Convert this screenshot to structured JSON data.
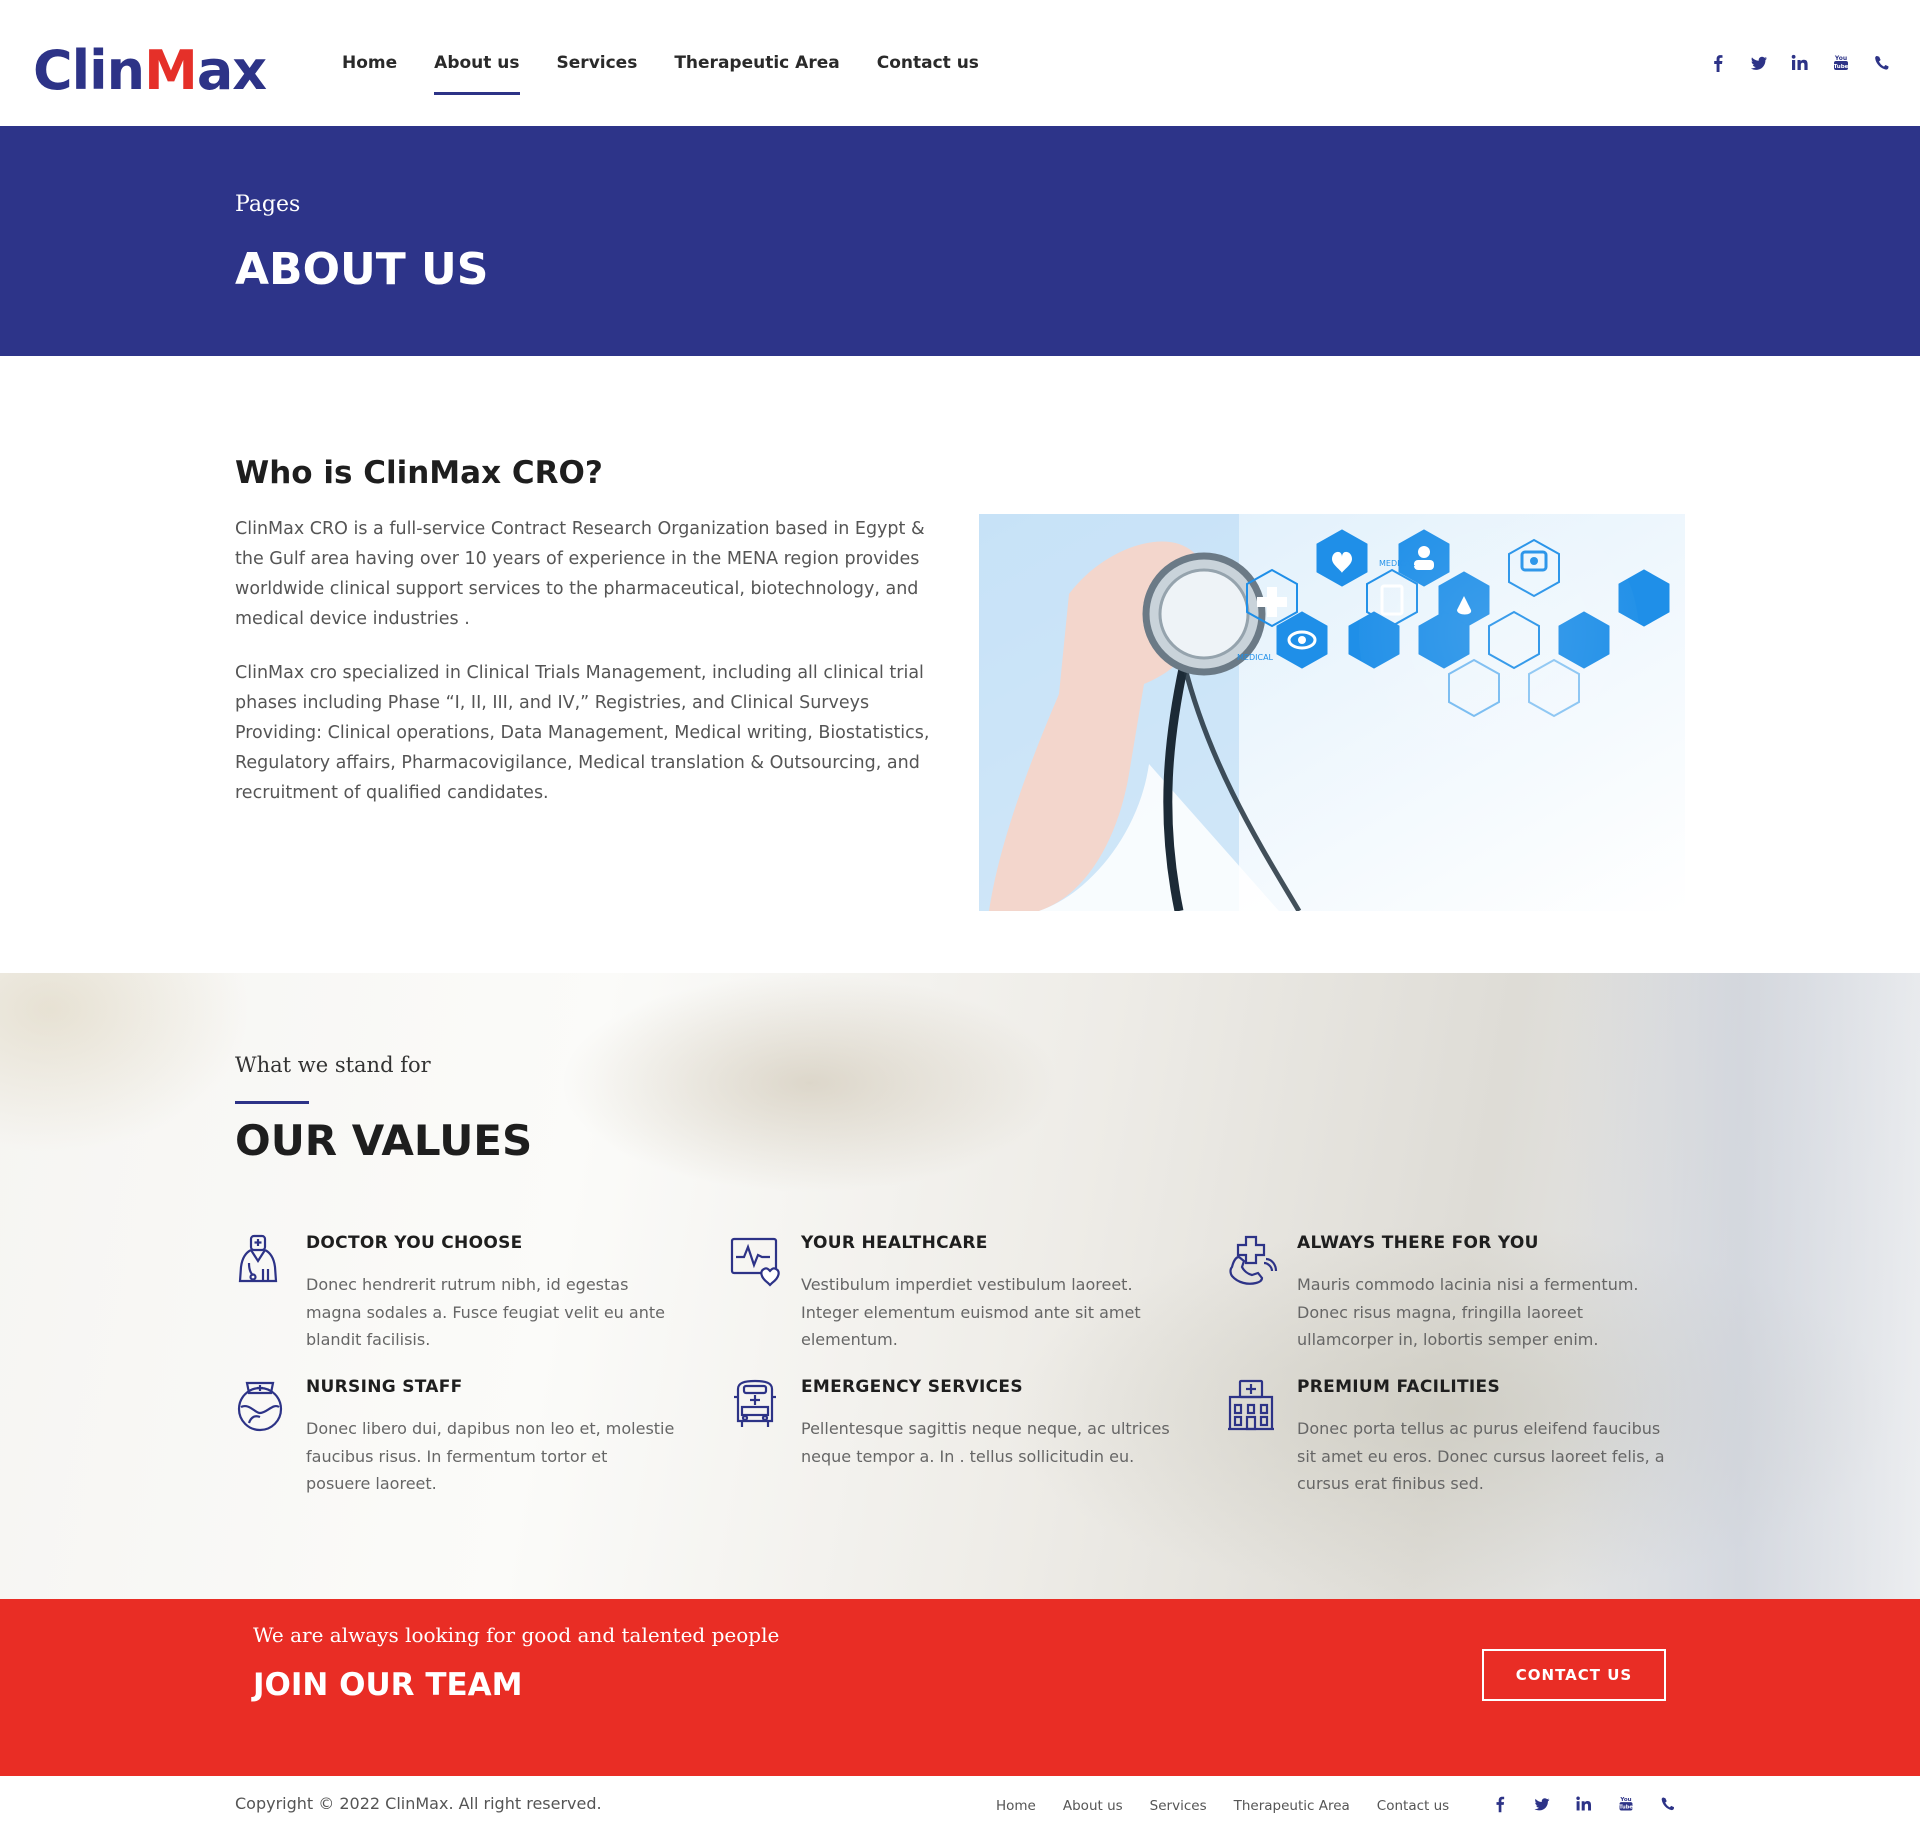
{
  "header": {
    "logo": {
      "part1": "Clin",
      "part2": "M",
      "part3": "ax"
    },
    "nav": [
      {
        "label": "Home",
        "active": false
      },
      {
        "label": "About us",
        "active": true
      },
      {
        "label": "Services",
        "active": false
      },
      {
        "label": "Therapeutic Area",
        "active": false
      },
      {
        "label": "Contact us",
        "active": false
      }
    ],
    "social": {
      "facebook": "f",
      "twitter": "t",
      "linkedin": "in",
      "youtube": "You Tube",
      "phone": "phone"
    }
  },
  "hero": {
    "small": "Pages",
    "title": "ABOUT US"
  },
  "about": {
    "heading": "Who is ClinMax CRO?",
    "p1": "ClinMax CRO is a full-service Contract Research Organization based in Egypt & the Gulf area having over 10 years of experience in the MENA region provides worldwide clinical support services to the pharmaceutical, biotechnology, and medical device industries .",
    "p2": "ClinMax cro specialized in Clinical Trials Management, including all clinical trial phases including Phase “I, II, III, and IV,” Registries, and Clinical Surveys Providing: Clinical operations, Data Management, Medical writing, Biostatistics, Regulatory affairs, Pharmacovigilance, Medical translation & Outsourcing, and recruitment of qualified candidates.",
    "image_labels": {
      "medical1": "MEDICAL",
      "medical2": "MEDICAL"
    }
  },
  "values": {
    "sub": "What we stand for",
    "title": "OUR VALUES",
    "items": [
      {
        "icon": "doctor-icon",
        "title": "DOCTOR YOU CHOOSE",
        "text": "Donec hendrerit rutrum nibh, id egestas magna sodales a. Fusce feugiat velit eu ante blandit facilisis."
      },
      {
        "icon": "heart-monitor-icon",
        "title": "YOUR HEALTHCARE",
        "text": "Vestibulum imperdiet vestibulum laoreet. Integer elementum euismod ante sit amet elementum."
      },
      {
        "icon": "medical-phone-icon",
        "title": "ALWAYS THERE FOR YOU",
        "text": "Mauris commodo lacinia nisi a fermentum. Donec risus magna, fringilla laoreet ullamcorper in, lobortis semper enim."
      },
      {
        "icon": "nurse-icon",
        "title": "NURSING STAFF",
        "text": "Donec libero dui, dapibus non leo et, molestie faucibus risus. In fermentum tortor et posuere laoreet."
      },
      {
        "icon": "ambulance-icon",
        "title": "EMERGENCY SERVICES",
        "text": "Pellentesque sagittis neque neque, ac ultrices neque tempor a. In . tellus sollicitudin eu."
      },
      {
        "icon": "hospital-icon",
        "title": "PREMIUM FACILITIES",
        "text": "Donec porta tellus ac purus eleifend faucibus sit amet eu eros. Donec cursus laoreet felis, a cursus erat finibus sed."
      }
    ]
  },
  "cta": {
    "small": "We are always looking for good and talented people",
    "title": "JOIN OUR TEAM",
    "button": "CONTACT US"
  },
  "footer": {
    "copyright": "Copyright © 2022 ClinMax. All right reserved.",
    "nav": [
      "Home",
      "About us",
      "Services",
      "Therapeutic Area",
      "Contact us"
    ]
  },
  "colors": {
    "brand_blue": "#2d3387",
    "brand_red": "#e53029",
    "hero_bg": "#2d3489",
    "cta_bg": "#e92d25"
  }
}
